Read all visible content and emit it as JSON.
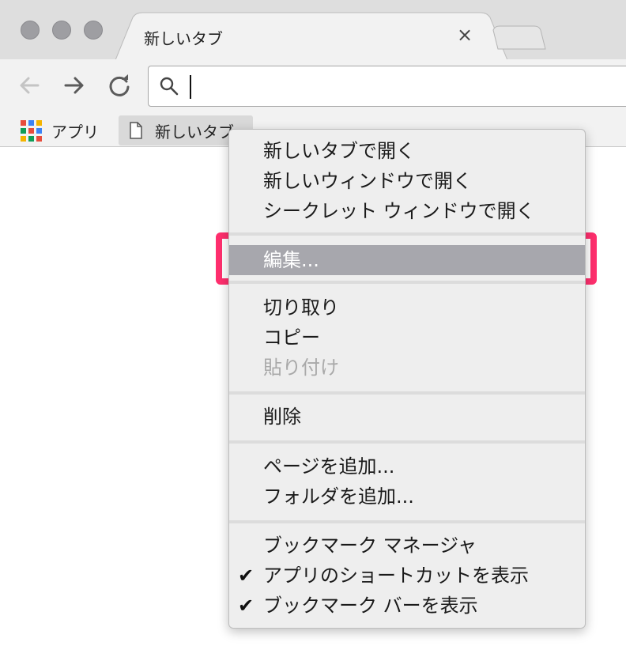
{
  "tab": {
    "title": "新しいタブ",
    "close_glyph": "×"
  },
  "omnibox": {
    "value": "",
    "placeholder": ""
  },
  "bookmarks_bar": {
    "apps_label": "アプリ",
    "new_tab_label": "新しいタブ",
    "apps_colors": [
      "#e74c3c",
      "#3b82f6",
      "#f4b400",
      "#0f9d58",
      "#e74c3c",
      "#3b82f6",
      "#f4b400",
      "#0f9d58",
      "#e74c3c"
    ]
  },
  "context_menu": {
    "open_in_new_tab": "新しいタブで開く",
    "open_in_new_window": "新しいウィンドウで開く",
    "open_incognito": "シークレット ウィンドウで開く",
    "edit": "編集...",
    "cut": "切り取り",
    "copy": "コピー",
    "paste": "貼り付け",
    "delete": "削除",
    "add_page": "ページを追加...",
    "add_folder": "フォルダを追加...",
    "bookmark_manager": "ブックマーク マネージャ",
    "show_apps_shortcut": "アプリのショートカットを表示",
    "show_bookmarks_bar": "ブックマーク バーを表示",
    "check_glyph": "✔"
  },
  "colors": {
    "highlight": "#a7a7ad",
    "annotation": "#ff2f6e"
  }
}
